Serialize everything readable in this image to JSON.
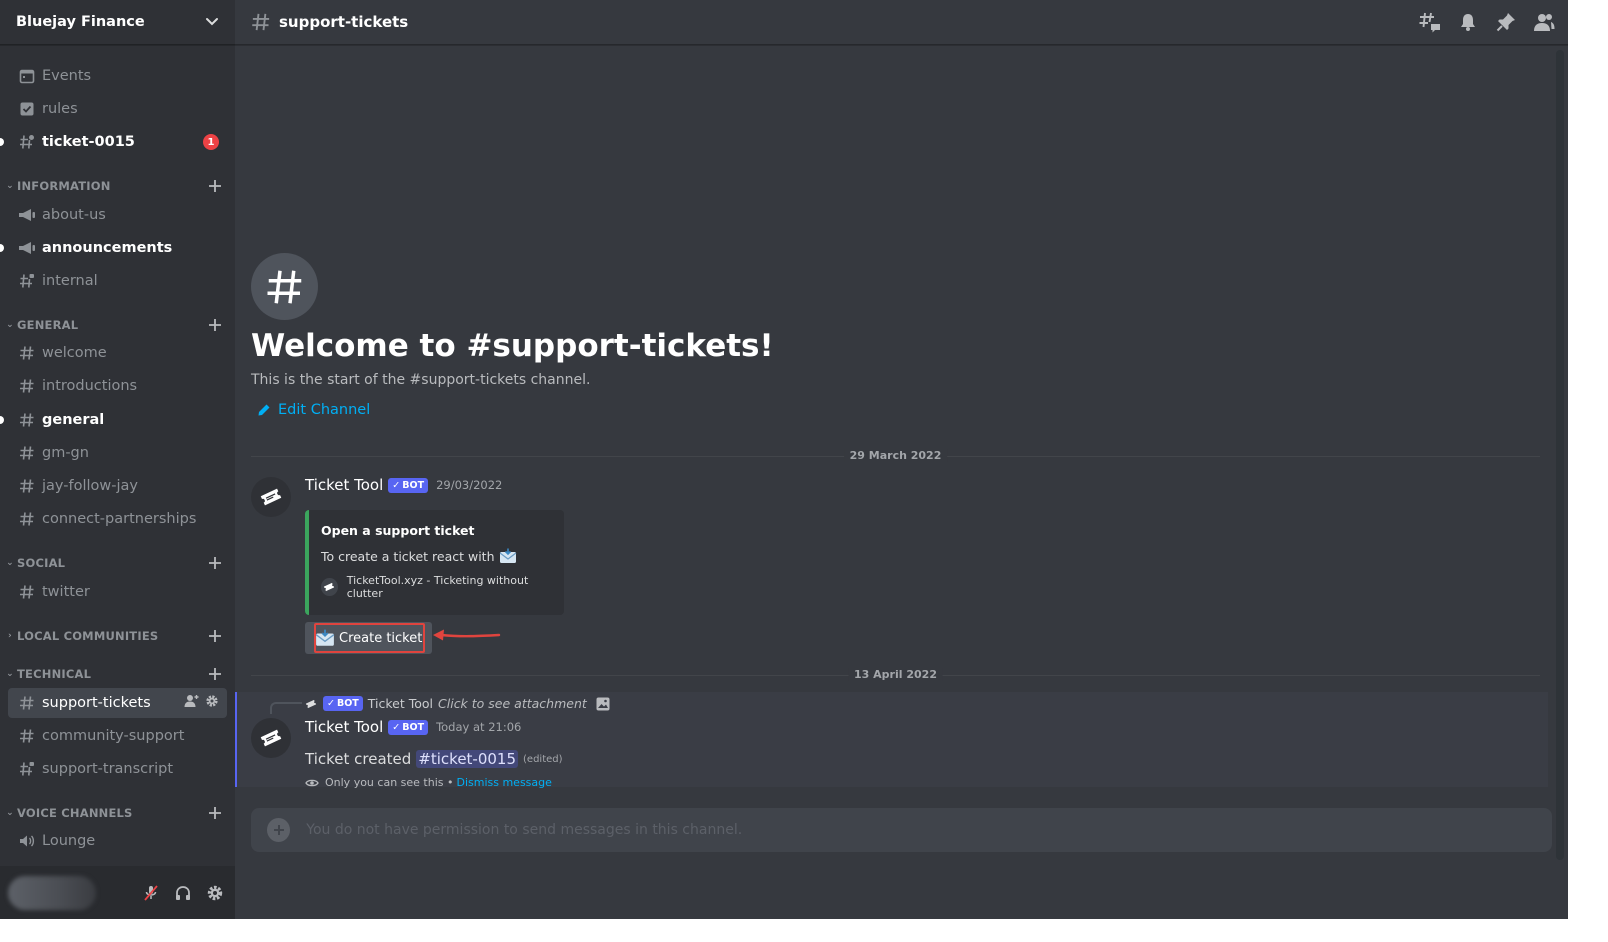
{
  "server": {
    "name": "Bluejay Finance"
  },
  "sidebar": {
    "top_items": [
      {
        "label": "Events",
        "icon": "calendar-icon"
      },
      {
        "label": "rules",
        "icon": "checkbox-icon"
      },
      {
        "label": "ticket-0015",
        "icon": "thread-hash-icon",
        "mentions": "1"
      }
    ],
    "categories": {
      "information": {
        "label": "INFORMATION",
        "channels": [
          "about-us",
          "announcements",
          "internal"
        ]
      },
      "general": {
        "label": "GENERAL",
        "channels": [
          "welcome",
          "introductions",
          "general",
          "gm-gn",
          "jay-follow-jay",
          "connect-partnerships"
        ]
      },
      "social": {
        "label": "SOCIAL",
        "channels": [
          "twitter"
        ]
      },
      "local": {
        "label": "LOCAL COMMUNITIES"
      },
      "technical": {
        "label": "TECHNICAL",
        "channels": [
          "support-tickets",
          "community-support",
          "support-transcript"
        ]
      },
      "voice": {
        "label": "VOICE CHANNELS",
        "channels": [
          "Lounge"
        ]
      }
    }
  },
  "channel": {
    "name": "support-tickets"
  },
  "welcome": {
    "title": "Welcome to #support-tickets!",
    "subtitle": "This is the start of the #support-tickets channel.",
    "edit_label": "Edit Channel"
  },
  "messages": {
    "divider_1": "29 March 2022",
    "divider_2": "13 April 2022",
    "bot_tag": "BOT",
    "first": {
      "author": "Ticket Tool",
      "timestamp": "29/03/2022",
      "embed": {
        "title": "Open a support ticket",
        "description": "To create a ticket react with",
        "footer": "TicketTool.xyz - Ticketing without clutter"
      },
      "button_label": "Create ticket"
    },
    "second": {
      "reply_author": "Ticket Tool",
      "reply_text": "Click to see attachment",
      "author": "Ticket Tool",
      "timestamp": "Today at 21:06",
      "content": "Ticket created",
      "mention": "ticket-0015",
      "edited": "(edited)",
      "ephemeral_note": "Only you can see this •",
      "dismiss": "Dismiss message"
    }
  },
  "composer": {
    "placeholder": "You do not have permission to send messages in this channel."
  },
  "colors": {
    "accent": "#5865f2",
    "link": "#00aff4",
    "embed_bar": "#3ba55d",
    "highlight": "#e0443e",
    "mention_badge": "#ed4245"
  }
}
